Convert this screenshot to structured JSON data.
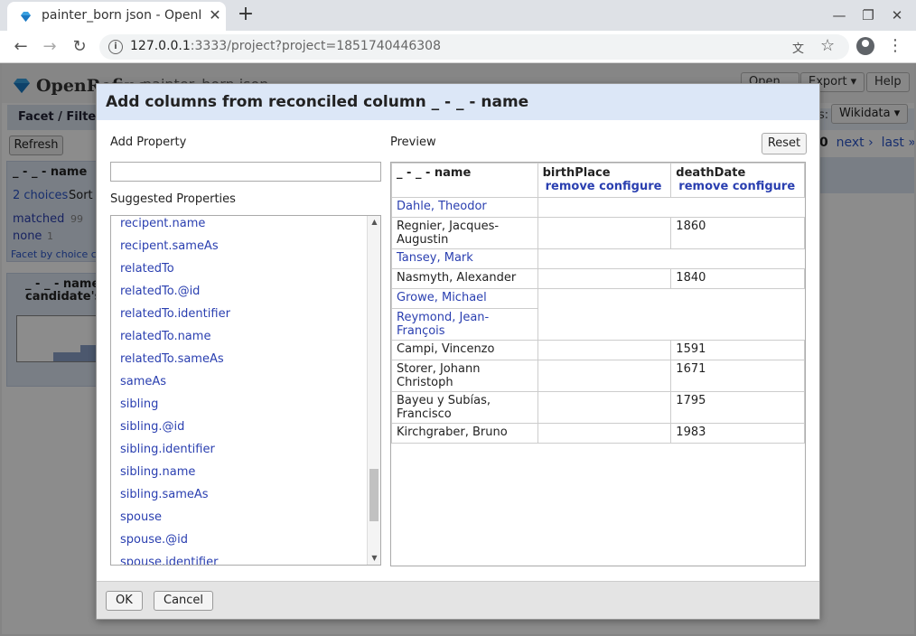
{
  "browser": {
    "tab_title": "painter_born json - OpenRefine",
    "url_host": "127.0.0.1",
    "url_rest": ":3333/project?project=1851740446308"
  },
  "app": {
    "logo_text": "OpenRefine",
    "project_name": "painter_born json",
    "open_label": "Open...",
    "export_label": "Export ▾",
    "help_label": "Help",
    "facet_tab_label": "Facet / Filter",
    "refresh_label": "Refresh",
    "facet1_title": "_ - _ - name",
    "facet1_choices": "2 choices",
    "facet1_sort": "Sort by",
    "facet1_matched": "matched",
    "facet1_matched_count": "99",
    "facet1_none": "none",
    "facet1_none_count": "1",
    "facet1_link": "Facet by choice counts",
    "facet2_title": "_ - _ - name",
    "facet2_sub": "candidate's score",
    "right_label": "s:",
    "wikidata_label": "Wikidata ▾",
    "pager_count": "0",
    "pager_next": "next ›",
    "pager_last": "last »"
  },
  "dialog": {
    "title": "Add columns from reconciled column _ - _ - name",
    "add_property_label": "Add Property",
    "add_property_value": "",
    "suggested_label": "Suggested Properties",
    "suggested": [
      "recipent.name",
      "recipent.sameAs",
      "relatedTo",
      "relatedTo.@id",
      "relatedTo.identifier",
      "relatedTo.name",
      "relatedTo.sameAs",
      "sameAs",
      "sibling",
      "sibling.@id",
      "sibling.identifier",
      "sibling.name",
      "sibling.sameAs",
      "spouse",
      "spouse.@id",
      "spouse.identifier"
    ],
    "preview_label": "Preview",
    "reset_label": "Reset",
    "ok_label": "OK",
    "cancel_label": "Cancel",
    "preview": {
      "col_name": "_ - _ - name",
      "col2": "birthPlace",
      "col3": "deathDate",
      "remove_label": "remove",
      "configure_label": "configure",
      "rows": [
        {
          "name": "Dahle, Theodor",
          "link": true,
          "birthPlace": "",
          "deathDate": "",
          "blank": true
        },
        {
          "name": "Regnier, Jacques-Augustin",
          "link": false,
          "birthPlace": "",
          "deathDate": "1860",
          "blank": false
        },
        {
          "name": "Tansey, Mark",
          "link": true,
          "birthPlace": "",
          "deathDate": "",
          "blank": true
        },
        {
          "name": "Nasmyth, Alexander",
          "link": false,
          "birthPlace": "",
          "deathDate": "1840",
          "blank": false
        },
        {
          "name": "Growe, Michael",
          "link": true,
          "birthPlace": "",
          "deathDate": "",
          "blank": true
        },
        {
          "name": "Reymond, Jean-François",
          "link": true,
          "birthPlace": "",
          "deathDate": "",
          "blank": true
        },
        {
          "name": "Campi, Vincenzo",
          "link": false,
          "birthPlace": "",
          "deathDate": "1591",
          "blank": false
        },
        {
          "name": "Storer, Johann Christoph",
          "link": false,
          "birthPlace": "",
          "deathDate": "1671",
          "blank": false
        },
        {
          "name": "Bayeu y Subías, Francisco",
          "link": false,
          "birthPlace": "",
          "deathDate": "1795",
          "blank": false
        },
        {
          "name": "Kirchgraber, Bruno",
          "link": false,
          "birthPlace": "",
          "deathDate": "1983",
          "blank": false
        }
      ]
    }
  },
  "colors": {
    "link": "#2a3fb0",
    "dialog_header": "#dce7f7",
    "facet_bg": "#dde6f3"
  }
}
